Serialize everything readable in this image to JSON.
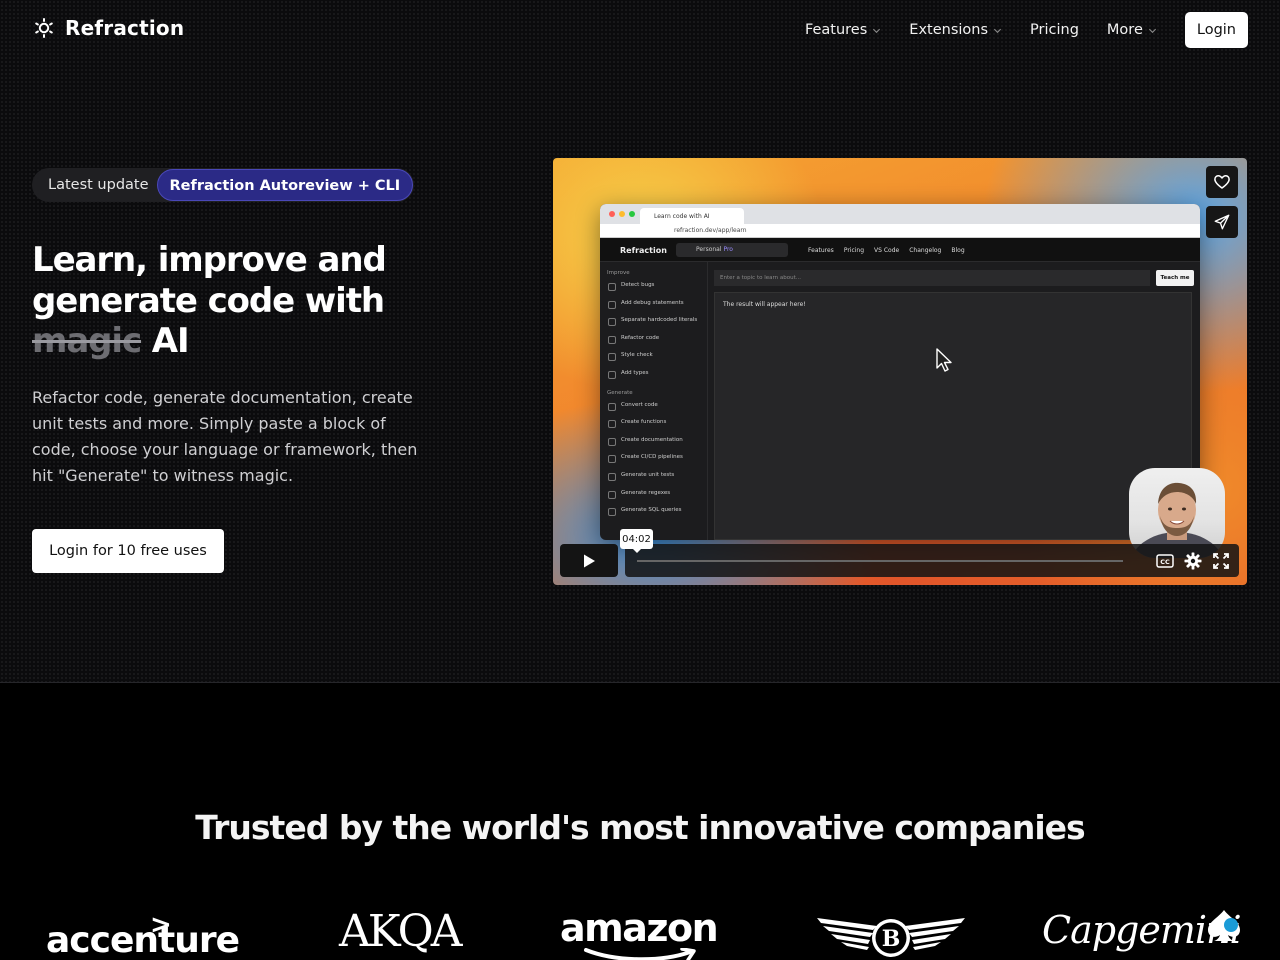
{
  "brand": {
    "name": "Refraction"
  },
  "nav": {
    "items": [
      {
        "label": "Features",
        "dropdown": true
      },
      {
        "label": "Extensions",
        "dropdown": true
      },
      {
        "label": "Pricing",
        "dropdown": false
      },
      {
        "label": "More",
        "dropdown": true
      }
    ],
    "login_label": "Login"
  },
  "hero": {
    "badge_label": "Latest update",
    "badge_tag": "Refraction Autoreview + CLI",
    "headline_line1": "Learn, improve and",
    "headline_line2": "generate code with",
    "headline_struck": "magic",
    "headline_end": "AI",
    "description": "Refactor code, generate documentation, create unit tests and more. Simply paste a block of code, choose your language or framework, then hit \"Generate\" to witness magic.",
    "cta_label": "Login for 10 free uses"
  },
  "video": {
    "time_tooltip": "04:02",
    "progress": 0,
    "screen": {
      "tab_title": "Learn code with AI",
      "url": "refraction.dev/app/learn",
      "app_title": "Refraction",
      "workspace": "Personal",
      "workspace_badge": "Pro",
      "menu": [
        "Features",
        "Pricing",
        "VS Code",
        "Changelog",
        "Blog"
      ],
      "improve_heading": "Improve",
      "improve_items": [
        "Detect bugs",
        "Add debug statements",
        "Separate hardcoded literals",
        "Refactor code",
        "Style check",
        "Add types"
      ],
      "generate_heading": "Generate",
      "generate_items": [
        "Convert code",
        "Create functions",
        "Create documentation",
        "Create CI/CD pipelines",
        "Generate unit tests",
        "Generate regexes",
        "Generate SQL queries"
      ],
      "input_placeholder": "Enter a topic to learn about...",
      "teach_button": "Teach me",
      "result_text": "The result will appear here!"
    }
  },
  "trusted": {
    "title": "Trusted by the world's most innovative companies",
    "logos": [
      "accenture",
      "AKQA",
      "amazon",
      "Bentley",
      "Capgemini"
    ]
  },
  "colors": {
    "background": "#000000",
    "badge_tag_bg": "#2b2a86",
    "button_bg": "#ffffff"
  }
}
